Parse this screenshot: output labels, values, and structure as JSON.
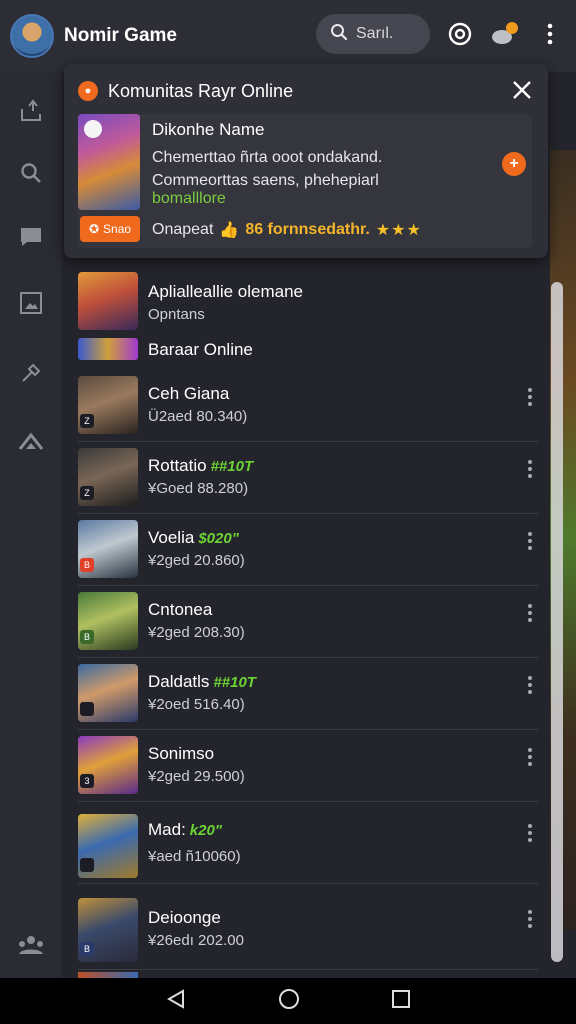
{
  "header": {
    "app_title": "Nomir Game",
    "search_label": "Sarıl.",
    "notification_badge": ""
  },
  "popup": {
    "title": "Komunitas Rayr Online",
    "card": {
      "title": "Dikonhe Name",
      "description": "Chemerttao ñrta ooot ondakand. Commeorttas saens, phehepiarl",
      "link": "bomalllore",
      "pill_label": "Snao",
      "stats_prefix": "Onapeat",
      "stats_count": "86 fornnsedathr.",
      "stars": "★★★"
    }
  },
  "sections": [
    {
      "title": "Aplialleallie olemane",
      "subtitle": "Opntans"
    },
    {
      "title": "Baraar Online"
    }
  ],
  "rows": [
    {
      "name": "Ceh Giana",
      "tag": "",
      "sub": "Ü2aed 80.340)",
      "corner": "Z"
    },
    {
      "name": "Rottatio",
      "tag": "##10T",
      "sub": "¥Goed 88.280)",
      "corner": "Z"
    },
    {
      "name": "Voelia",
      "tag": "$020\"",
      "sub": "¥2ged 20.860)",
      "corner": "B"
    },
    {
      "name": "Cntonea",
      "tag": "",
      "sub": "¥2ged 208.30)",
      "corner": "B"
    },
    {
      "name": "Daldatls",
      "tag": "##10T",
      "sub": "¥2oed 516.40)",
      "corner": ""
    },
    {
      "name": "Sonimso",
      "tag": "",
      "sub": "¥2ged 29.500)",
      "corner": "3"
    },
    {
      "name": "Mad:",
      "tag": "k20\"",
      "sub": "¥aed ñ10060)",
      "corner": ""
    },
    {
      "name": "Deioonge",
      "tag": "",
      "sub": "¥26edı 202.00",
      "corner": "B"
    }
  ],
  "colors": {
    "accent": "#f06a1d",
    "green_tag": "#6bd433",
    "background": "#24252c"
  }
}
